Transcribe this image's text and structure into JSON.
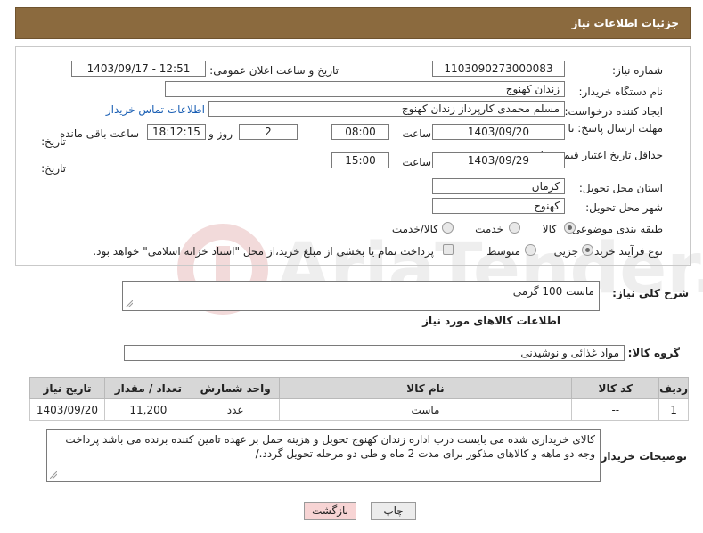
{
  "header": {
    "title": "جزئیات اطلاعات نیاز"
  },
  "form": {
    "need_number_label": "شماره نیاز:",
    "need_number": "1103090273000083",
    "announce_label": "تاریخ و ساعت اعلان عمومی:",
    "announce_value": "1403/09/17 - 12:51",
    "buyer_org_label": "نام دستگاه خریدار:",
    "buyer_org": "زندان کهنوج",
    "creator_label": "ایجاد کننده درخواست:",
    "creator": "مسلم محمدی کارپرداز زندان کهنوج",
    "contact_link": "اطلاعات تماس خریدار",
    "reply_deadline_label_1": "مهلت ارسال پاسخ: تا",
    "reply_deadline_label_2": "تاریخ:",
    "reply_date": "1403/09/20",
    "time_label": "ساعت",
    "reply_time": "08:00",
    "days": "2",
    "days_label": "روز و",
    "remaining_time": "18:12:15",
    "remaining_label": "ساعت باقی مانده",
    "price_valid_label_1": "حداقل تاریخ اعتبار قیمت: تا",
    "price_valid_label_2": "تاریخ:",
    "price_date": "1403/09/29",
    "price_time": "15:00",
    "province_label": "استان محل تحویل:",
    "province": "کرمان",
    "city_label": "شهر محل تحویل:",
    "city": "کهنوج",
    "category_label": "طبقه بندی موضوعی:",
    "category_options": [
      "کالا",
      "خدمت",
      "کالا/خدمت"
    ],
    "category_selected": "کالا",
    "process_label": "نوع فرآیند خرید :",
    "process_options": [
      "جزیی",
      "متوسط"
    ],
    "process_selected": "جزیی",
    "payment_note": "پرداخت تمام یا بخشی از مبلغ خرید،از محل \"اسناد خزانه اسلامی\" خواهد بود."
  },
  "description": {
    "label": "شرح کلی نیاز:",
    "value": "ماست 100 گرمی"
  },
  "goods_info_title": "اطلاعات کالاهای مورد نیاز",
  "goods_group": {
    "label": "گروه کالا:",
    "value": "مواد غذائی و نوشیدنی"
  },
  "table": {
    "headers": [
      "ردیف",
      "کد کالا",
      "نام کالا",
      "واحد شمارش",
      "تعداد / مقدار",
      "تاریخ نیاز"
    ],
    "rows": [
      [
        "1",
        "--",
        "ماست",
        "عدد",
        "11,200",
        "1403/09/20"
      ]
    ]
  },
  "buyer_notes": {
    "label": "توضیحات خریدار:",
    "value": "کالای خریداری شده می بایست درب اداره زندان کهنوج تحویل و هزینه حمل بر عهده تامین کننده برنده می باشد پرداخت وجه دو ماهه و کالاهای مذکور برای مدت 2 ماه و طی دو مرحله تحویل گردد./"
  },
  "buttons": {
    "print": "چاپ",
    "back": "بازگشت"
  },
  "watermark": {
    "text": "AriaTender.net"
  },
  "colors": {
    "header_bg": "#8b6a3e",
    "table_header_bg": "#d7d7d7",
    "link": "#1a5fb4",
    "back_button_bg": "#f7d4d4"
  }
}
